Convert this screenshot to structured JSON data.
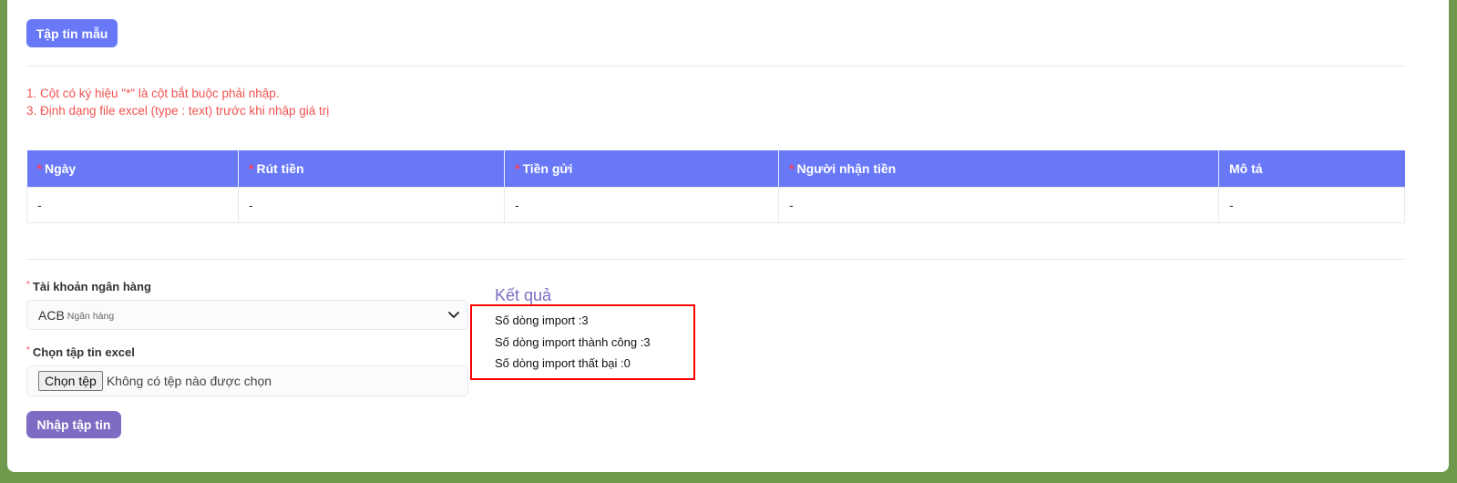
{
  "toolbar": {
    "sample_file_label": "Tập tin mẫu"
  },
  "notes": [
    "1. Cột có ký hiệu \"*\" là cột bắt buộc phải nhập.",
    "3. Định dạng file excel (type : text) trước khi nhập giá trị"
  ],
  "table": {
    "required_marker": "*",
    "columns": [
      "Ngày",
      "Rút tiền",
      "Tiền gửi",
      "Người nhận tiền",
      "Mô tả"
    ],
    "row": [
      "-",
      "-",
      "-",
      "-",
      "-"
    ]
  },
  "form": {
    "required_marker": "*",
    "bank_account_label": "Tài khoản ngân hàng",
    "bank_account_value": "ACB",
    "bank_account_sub": "Ngân hàng",
    "file_label": "Chọn tập tin excel",
    "file_button": "Chọn tệp",
    "file_none": "Không có tệp nào được chọn",
    "import_button": "Nhập tập tin"
  },
  "result": {
    "title": "Kết quả",
    "total_rows": "Số dòng import :3",
    "success_rows": "Số dòng import thành công :3",
    "failed_rows": "Số dòng import thất bại :0"
  },
  "colors": {
    "primary": "#6878f7",
    "import_button": "#7e6cc4",
    "required": "#ff3d5a",
    "notes": "#ef5350",
    "highlight_box": "#ff0000"
  }
}
